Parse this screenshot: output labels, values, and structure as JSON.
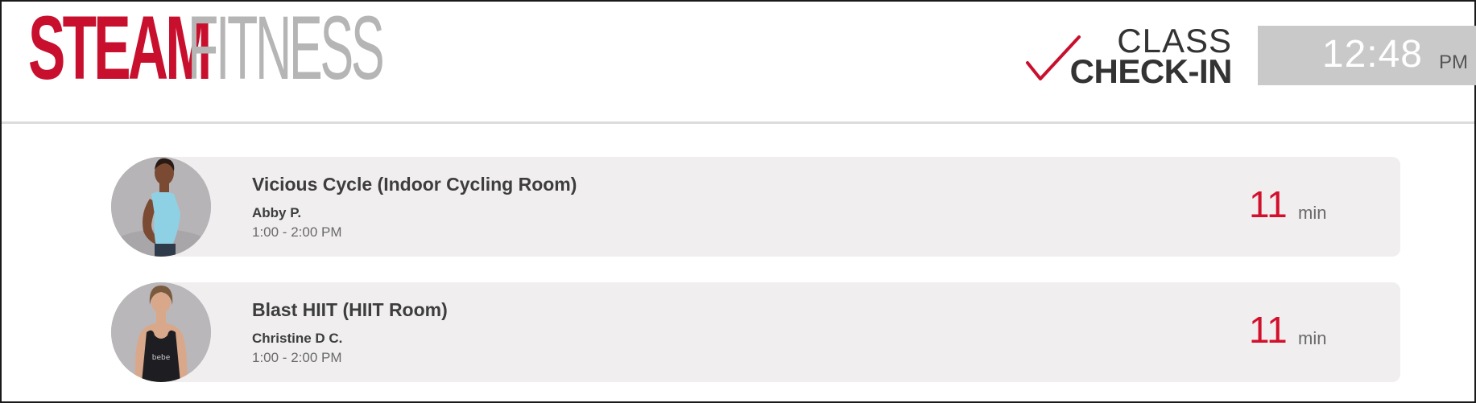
{
  "brand": {
    "name_part1": "STEAM",
    "name_part2": "FITNESS"
  },
  "checkin": {
    "line1": "CLASS",
    "line2": "CHECK-IN"
  },
  "clock": {
    "time": "12:48",
    "ampm": "PM"
  },
  "classes": [
    {
      "name": "Vicious Cycle (Indoor Cycling Room)",
      "instructor": "Abby P.",
      "time": "1:00 - 2:00 PM",
      "countdown_value": "11",
      "countdown_unit": "min",
      "avatar_shirt_color": "#8fd1e4"
    },
    {
      "name": "Blast HIIT (HIIT Room)",
      "instructor": "Christine D C.",
      "time": "1:00 - 2:00 PM",
      "countdown_value": "11",
      "countdown_unit": "min",
      "avatar_shirt_color": "#1e1e22"
    }
  ],
  "colors": {
    "brand_red": "#c8102e",
    "brand_gray": "#b5b5b5",
    "countdown_red": "#d3102c",
    "card_bg": "#f0eeef",
    "clock_bg": "#c9c9c9"
  }
}
